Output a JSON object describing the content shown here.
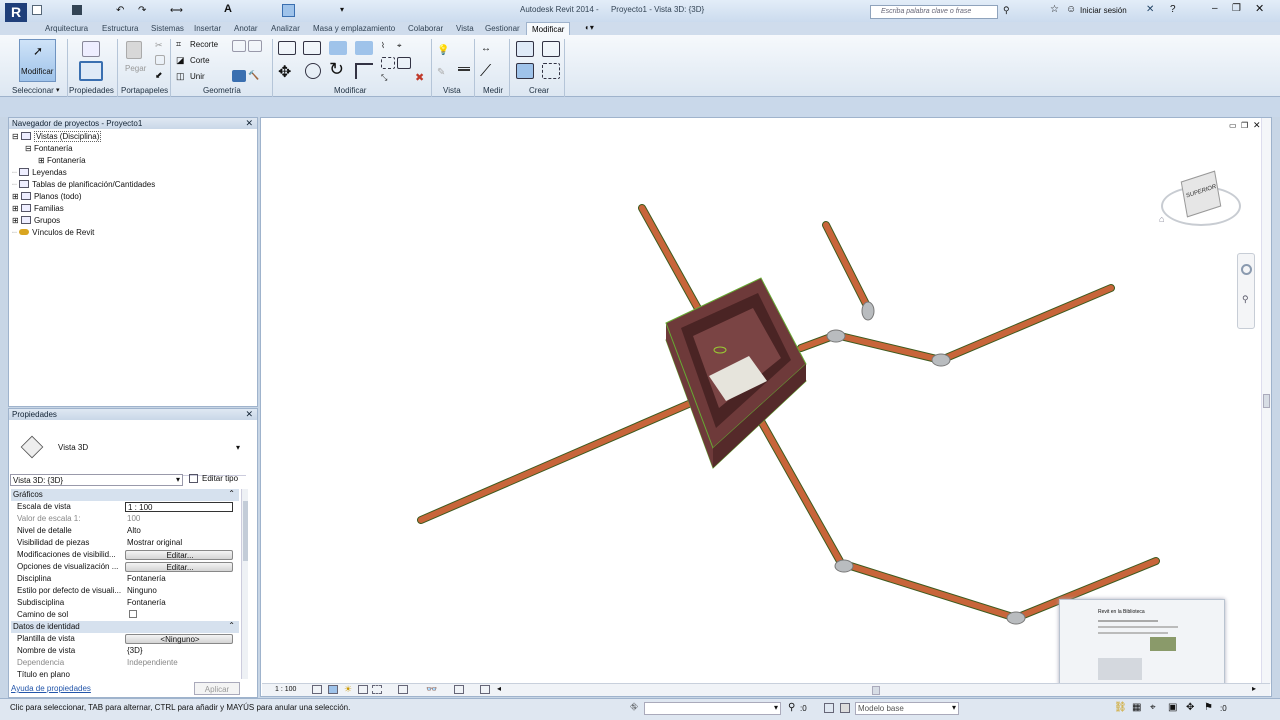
{
  "app": {
    "title": "Autodesk Revit 2014 -",
    "project_title": "Proyecto1 - Vista 3D: {3D}",
    "search_placeholder": "Escriba palabra clave o frase",
    "signin": "Iniciar sesión"
  },
  "ribbon": {
    "tabs": [
      "Arquitectura",
      "Estructura",
      "Sistemas",
      "Insertar",
      "Anotar",
      "Analizar",
      "Masa y emplazamiento",
      "Colaborar",
      "Vista",
      "Gestionar",
      "Modificar"
    ],
    "active_tab": "Modificar",
    "modify_label": "Modificar",
    "paste_label": "Pegar",
    "recorte_label": "Recorte",
    "corte_label": "Corte",
    "unir_label": "Unir",
    "panels": {
      "seleccionar": "Seleccionar",
      "propiedades": "Propiedades",
      "portapapeles": "Portapapeles",
      "geometria": "Geometría",
      "modificar": "Modificar",
      "vista": "Vista",
      "medir": "Medir",
      "crear": "Crear"
    }
  },
  "browser": {
    "title": "Navegador de proyectos - Proyecto1",
    "items": [
      "Vistas (Disciplina)",
      "Fontanería",
      "Fontanería",
      "Leyendas",
      "Tablas de planificación/Cantidades",
      "Planos (todo)",
      "Familias",
      "Grupos",
      "Vínculos de Revit"
    ]
  },
  "properties": {
    "title": "Propiedades",
    "type_name": "Vista 3D",
    "selector": "Vista 3D: {3D}",
    "edit_type": "Editar tipo",
    "groups": {
      "graficos": "Gráficos",
      "identidad": "Datos de identidad"
    },
    "rows": [
      {
        "k": "Escala de vista",
        "v": "1 : 100"
      },
      {
        "k": "Valor de escala    1:",
        "v": "100"
      },
      {
        "k": "Nivel de detalle",
        "v": "Alto"
      },
      {
        "k": "Visibilidad de piezas",
        "v": "Mostrar original"
      },
      {
        "k": "Modificaciones de visibilid...",
        "v": "Editar..."
      },
      {
        "k": "Opciones de visualización ...",
        "v": "Editar..."
      },
      {
        "k": "Disciplina",
        "v": "Fontanería"
      },
      {
        "k": "Estilo por defecto de visuali...",
        "v": "Ninguno"
      },
      {
        "k": "Subdisciplina",
        "v": "Fontanería"
      },
      {
        "k": "Camino de sol",
        "v": ""
      }
    ],
    "rows2": [
      {
        "k": "Plantilla de vista",
        "v": "<Ninguno>"
      },
      {
        "k": "Nombre de vista",
        "v": "{3D}"
      },
      {
        "k": "Dependencia",
        "v": "Independiente"
      },
      {
        "k": "Título en plano",
        "v": ""
      }
    ],
    "help_link": "Ayuda de propiedades",
    "apply": "Aplicar"
  },
  "viewcube": {
    "face": "SUPERIOR"
  },
  "viewbar": {
    "scale": "1 : 100"
  },
  "status": {
    "message": "Clic para seleccionar, TAB para alternar, CTRL para añadir y MAYÚS para anular una selección.",
    "count": ":0",
    "model": "Modelo base"
  },
  "thumbnail": {
    "title": "Revit en la Biblioteca"
  },
  "colors": {
    "pipe": "#c8653a",
    "brick": "#6e3a3a",
    "accent": "#3a6fb0"
  }
}
